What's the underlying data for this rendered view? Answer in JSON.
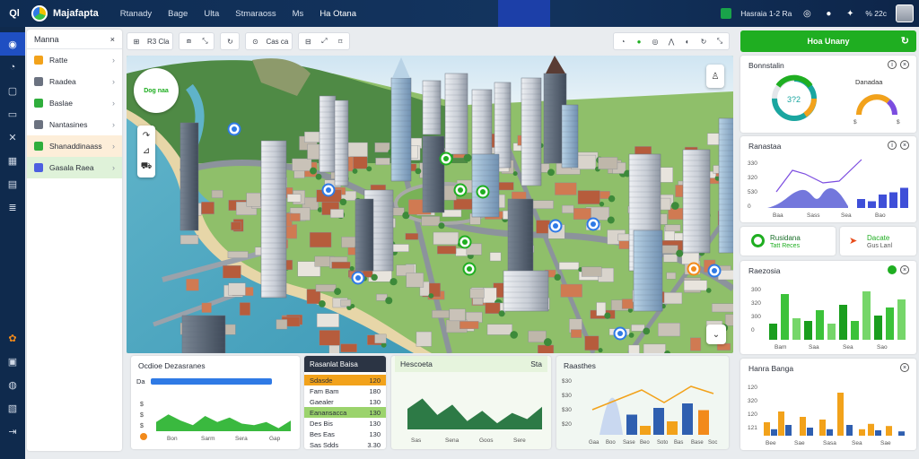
{
  "app": {
    "title": "Majafapta",
    "brand_icon": "Ql"
  },
  "top_nav": [
    "Rtanady",
    "Bage",
    "Ulta",
    "Stmaraoss",
    "Ms",
    "Ha Otana"
  ],
  "top_right": {
    "status_text": "Hasraia 1-2 Ra",
    "user_text": "% 22c"
  },
  "layers_panel": {
    "title": "Manna",
    "items": [
      {
        "label": "Ratte",
        "color": "#f2a21b",
        "highlight": ""
      },
      {
        "label": "Raadea",
        "color": "#6b7280",
        "highlight": ""
      },
      {
        "label": "Baslae",
        "color": "#2fae3c",
        "highlight": ""
      },
      {
        "label": "Nantasines",
        "color": "#6b7280",
        "highlight": ""
      },
      {
        "label": "Shanaddinaass",
        "color": "#2fae3c",
        "highlight": "orange"
      },
      {
        "label": "Gasala Raea",
        "color": "#4c5fe0",
        "highlight": "green"
      }
    ]
  },
  "map_toolbar": {
    "group1": "R3 Cla",
    "group2": "Cas ca"
  },
  "map": {
    "legend_text": "Dog naa"
  },
  "bottom": {
    "w1": {
      "title": "Ocdioe Dezasranes",
      "rows": [
        {
          "label": "Da",
          "value": 0.9,
          "color": "#2f7ae5"
        },
        {
          "label": "$3",
          "value": 0.0,
          "color": "#2fae3c"
        },
        {
          "label": "3",
          "value": 0.0,
          "color": "#2fae3c"
        },
        {
          "label": "$",
          "value": 0.0,
          "color": "#2fae3c"
        }
      ],
      "x_labels": [
        "Bon",
        "Sarm",
        "Sera",
        "Gap"
      ],
      "series": [
        0.3,
        0.55,
        0.35,
        0.2,
        0.5,
        0.3,
        0.45,
        0.25,
        0.2,
        0.3,
        0.1,
        0.35
      ]
    },
    "w2": {
      "title": "Rasanlat Baisa",
      "rows": [
        {
          "label": "Sdasde",
          "value": "120",
          "color": "#f2a21b",
          "fill": 0.8
        },
        {
          "label": "Fam Bam",
          "value": "180",
          "color": "#dfe3e8",
          "fill": 0
        },
        {
          "label": "Gaealer",
          "value": "130",
          "color": "#dfe3e8",
          "fill": 0
        },
        {
          "label": "Eanansacca",
          "value": "130",
          "color": "#9bd36c",
          "fill": 0.85
        },
        {
          "label": "Des Bis",
          "value": "130",
          "color": "#dfe3e8",
          "fill": 0
        },
        {
          "label": "Bes Eas",
          "value": "130",
          "color": "#dfe3e8",
          "fill": 0
        },
        {
          "label": "Sas Sdds",
          "value": "3.30",
          "color": "#dfe3e8",
          "fill": 0
        }
      ]
    },
    "w3": {
      "title": "Hescoeta",
      "value": "Sta",
      "x_labels": [
        "Sas",
        "Sena",
        "Goos",
        "Sere"
      ],
      "series": [
        0.5,
        0.75,
        0.35,
        0.6,
        0.2,
        0.45,
        0.15,
        0.4,
        0.25,
        0.55
      ]
    },
    "w4": {
      "title": "Raasthes",
      "y_ticks": [
        "$30",
        "$30",
        "$30",
        "$20"
      ],
      "x_labels": [
        "Gaa",
        "Boo",
        "Sase",
        "Beo",
        "Soto",
        "Bas",
        "Base",
        "Soc"
      ]
    }
  },
  "right_panel": {
    "header": "Hoa Unany",
    "c1": {
      "title": "Bonnstalin",
      "gauge1_value": "3?2",
      "gauge1_fill": 0.75,
      "gauge2_label": "Danadaa",
      "gauge2_fill": 0.65
    },
    "c2": {
      "title": "Ranastaa",
      "y_ticks": [
        "330",
        "320",
        "530",
        "0"
      ],
      "x_labels": [
        "Baa",
        "Sass",
        "Sea",
        "Bao"
      ],
      "bars": [
        0.2,
        0.35,
        0.5,
        0.3,
        0.65,
        0.25,
        0.15,
        0.2,
        0.3,
        0.4,
        0.25
      ]
    },
    "c3": {
      "left_title": "Rusidana",
      "left_sub": "Tatt Reces",
      "right_title": "Dacate",
      "right_sub": "Gus Lanl"
    },
    "c4": {
      "title": "Raezosia",
      "y_ticks": [
        "300",
        "320",
        "300",
        "0"
      ],
      "x_labels": [
        "Bam",
        "Saa",
        "Sea",
        "Sao"
      ],
      "bars": [
        0.3,
        0.85,
        0.4,
        0.35,
        0.55,
        0.3,
        0.65,
        0.35,
        0.9,
        0.45,
        0.6,
        0.75
      ]
    },
    "c5": {
      "title": "Hanra Banga",
      "y_ticks": [
        "120",
        "320",
        "120",
        "121"
      ],
      "x_labels": [
        "Bee",
        "Sae",
        "Sasa",
        "Sea",
        "Sae"
      ]
    }
  },
  "colors": {
    "accent": "#1fae21",
    "nav": "#0f2c52",
    "rail_active": "#1f4fc2"
  }
}
